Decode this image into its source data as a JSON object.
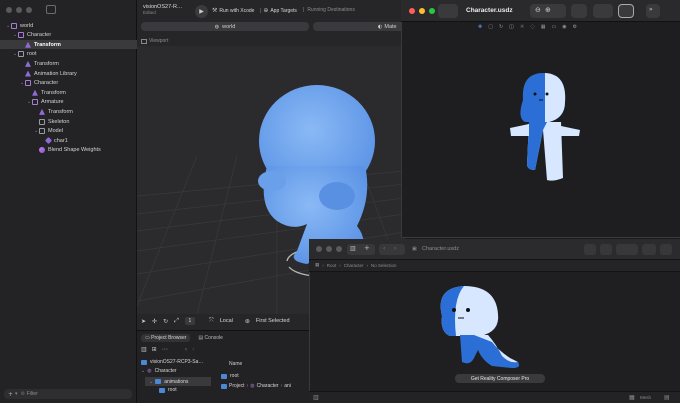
{
  "outline": {
    "items": [
      {
        "label": "world",
        "icon": "entity-icon",
        "depth": 0,
        "expanded": true
      },
      {
        "label": "Character",
        "icon": "entity-icon",
        "depth": 1,
        "expanded": true
      },
      {
        "label": "Transform",
        "icon": "transform-icon",
        "depth": 2,
        "selected": true
      },
      {
        "label": "root",
        "icon": "model-icon",
        "depth": 1,
        "expanded": true
      },
      {
        "label": "Transform",
        "icon": "transform-icon",
        "depth": 2
      },
      {
        "label": "Animation Library",
        "icon": "transform-icon",
        "depth": 2
      },
      {
        "label": "Character",
        "icon": "entity-icon",
        "depth": 2,
        "expanded": true
      },
      {
        "label": "Transform",
        "icon": "transform-icon",
        "depth": 3
      },
      {
        "label": "Armature",
        "icon": "entity-icon",
        "depth": 3,
        "expanded": true
      },
      {
        "label": "Transform",
        "icon": "transform-icon",
        "depth": 4
      },
      {
        "label": "Skeleton",
        "icon": "model-icon",
        "depth": 4
      },
      {
        "label": "Model",
        "icon": "model-icon",
        "depth": 4,
        "expanded": true
      },
      {
        "label": "char1",
        "icon": "mesh-icon",
        "depth": 5
      },
      {
        "label": "Blend Shape Weights",
        "icon": "blend-icon",
        "depth": 4
      }
    ],
    "filter_placeholder": "Filter"
  },
  "main": {
    "project_name": "visionOS27-R…",
    "project_sub": "Edited",
    "run_label": "Run with Xcode",
    "targets_label": "App Targets",
    "running_label": "Running Destinations",
    "tab_world": "world",
    "tab_material": "Mate",
    "viewport_label": "Viewport",
    "tool_count": "1",
    "space_label": "Local",
    "selection_label": "First Selected",
    "project_browser": "Project Browser",
    "console": "Console",
    "browser_root": "visionOS27-RCP3-Sa…",
    "browser_folder": "Character",
    "browser_subfolder": "animations",
    "browser_item": "root",
    "column_name": "Name",
    "file_root": "root",
    "breadcrumb_project": "Project",
    "breadcrumb_character": "Character",
    "breadcrumb_anim": "ani"
  },
  "quicklook": {
    "title": "Character.usdz"
  },
  "rcp": {
    "title": "Character.usdz",
    "path_1": "Root",
    "path_2": "Character",
    "path_3": "No Selection",
    "cta_label": "Get Reality Composer Pro",
    "zoom_label": "Mesh"
  },
  "colors": {
    "accent": "#3b82f6",
    "character_blue": "#6fa5ef",
    "character_deep": "#2b6fd6",
    "character_light": "#d6e7ff"
  }
}
